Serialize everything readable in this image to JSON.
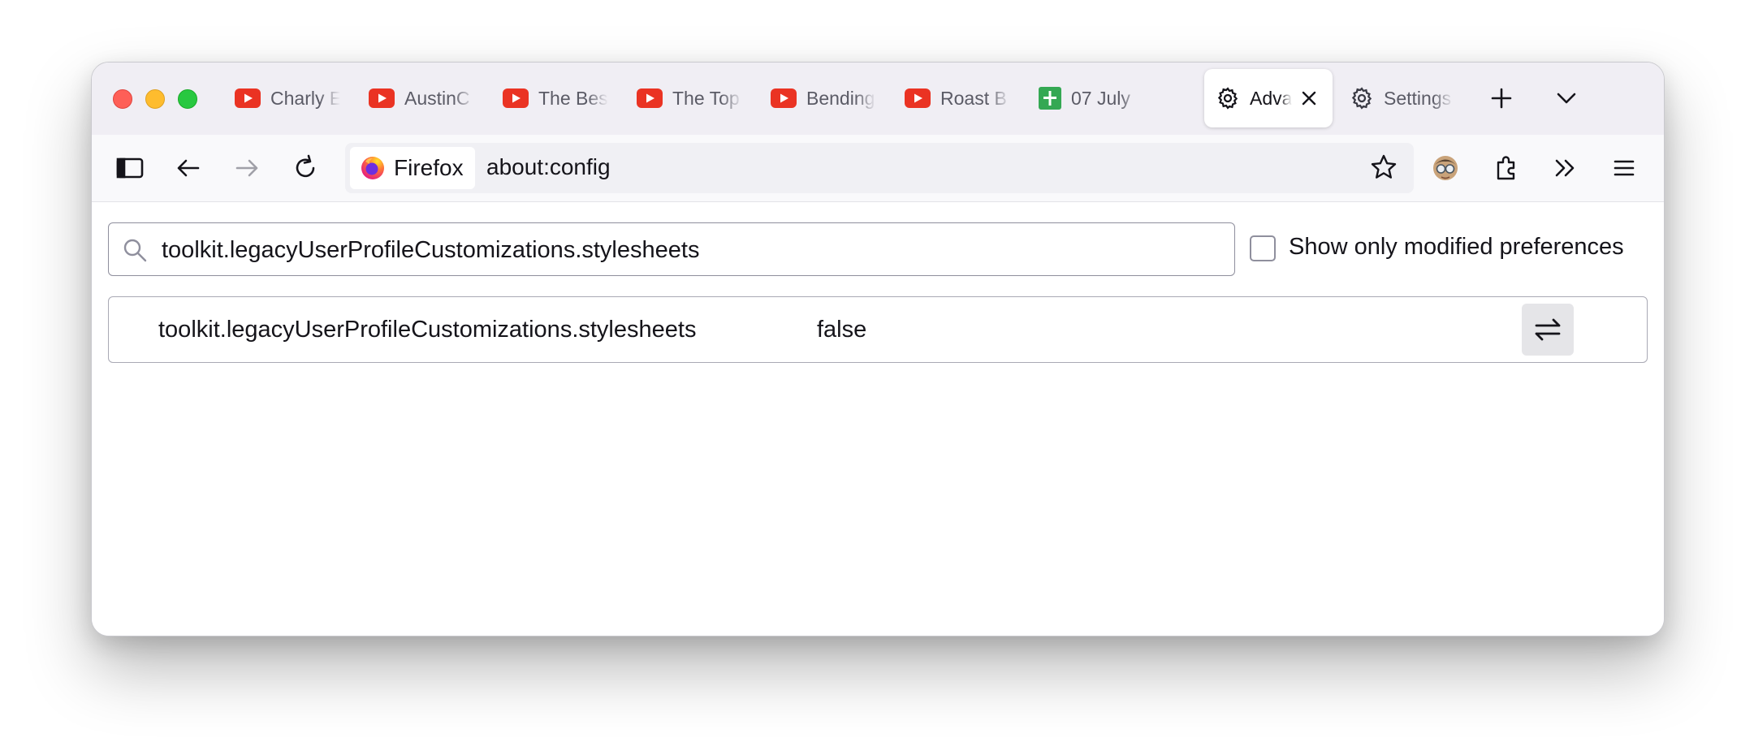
{
  "tabs": [
    {
      "title": "Charly E",
      "icon": "youtube-icon"
    },
    {
      "title": "AustinC",
      "icon": "youtube-icon"
    },
    {
      "title": "The Bes",
      "icon": "youtube-icon"
    },
    {
      "title": "The Top",
      "icon": "youtube-icon"
    },
    {
      "title": "Bending",
      "icon": "youtube-icon"
    },
    {
      "title": "Roast B",
      "icon": "youtube-icon"
    },
    {
      "title": "07 July",
      "icon": "google-sheets-icon"
    },
    {
      "title": "Adva",
      "icon": "gear-icon",
      "active": true
    },
    {
      "title": "Settings",
      "icon": "gear-icon"
    }
  ],
  "urlbar": {
    "identity_label": "Firefox",
    "url": "about:config"
  },
  "search": {
    "value": "toolkit.legacyUserProfileCustomizations.stylesheets"
  },
  "filter": {
    "label": "Show only modified preferences",
    "checked": false
  },
  "preference": {
    "name": "toolkit.legacyUserProfileCustomizations.stylesheets",
    "value": "false"
  },
  "colors": {
    "youtube_red": "#ea3323",
    "sheets_green": "#34a853",
    "tabbar_bg": "#f0eef4",
    "toggle_bg": "#e5e5e8"
  }
}
